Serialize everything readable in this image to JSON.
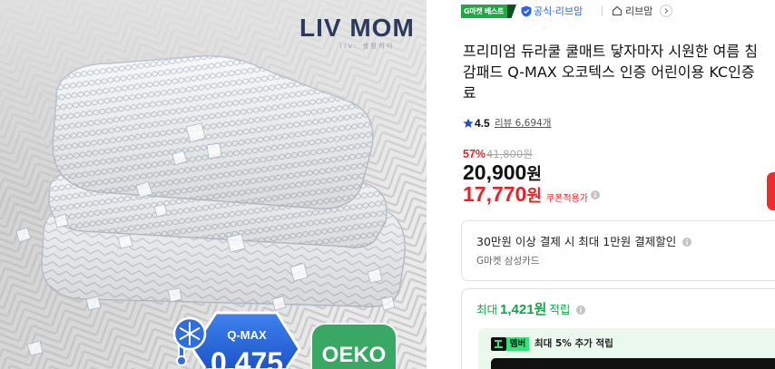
{
  "colors": {
    "brand_navy": "#2c3a5d",
    "gmarket_green": "#1fa845",
    "price_red": "#eb2127",
    "points_green": "#13a54a",
    "official_blue": "#2b63e8",
    "star_blue": "#1e4bd2",
    "qmax_blue": "#2d6fe0",
    "oeko_green": "#3aa865",
    "member_badge_green": "#36e07a"
  },
  "product_image": {
    "brand_logo": "LIV MOM",
    "brand_tagline": "liv: 생활하다",
    "qmax_badge": {
      "label": "Q-MAX",
      "value": "0.475",
      "icon": "snowflake-thermometer-icon"
    },
    "oeko_badge": {
      "label": "OEKO"
    }
  },
  "header": {
    "best_badge": "G마켓 베스트",
    "official_icon": "shield-check-icon",
    "official_label": "공식·리브맘",
    "store_icon": "house-icon",
    "store_name": "리브맘",
    "store_link_icon": "chevron-right-circle-icon"
  },
  "title_lines": [
    "프리미엄 듀라쿨 쿨매트 닿자마자 시원한 여름 침",
    "감패드 Q-MAX 오코텍스 인증 어린이용 KC인증",
    "료"
  ],
  "rating": {
    "icon": "star-icon",
    "score": "4.5",
    "reviews": "리뷰 6,694개"
  },
  "price": {
    "discount_rate": "57%",
    "original_price": "41,800원",
    "sale_amount": "20,900",
    "sale_unit": "원",
    "coupon_amount": "17,770",
    "coupon_unit": "원",
    "coupon_label": "쿠폰적용가"
  },
  "card_discount": {
    "headline": "30만원 이상 결제 시 최대 1만원 결제할인",
    "card_name": "G마켓 삼성카드"
  },
  "points": {
    "prefix": "최대",
    "amount": "1,421원",
    "suffix": "적립",
    "member_badge": "멤버",
    "member_text": "최대 5% 추가 적립"
  }
}
